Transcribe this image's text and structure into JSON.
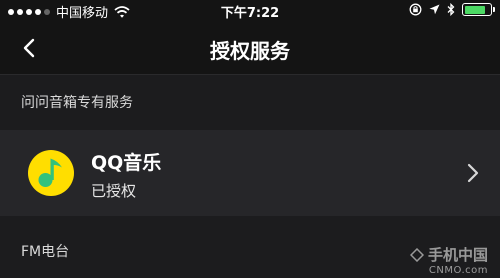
{
  "status_bar": {
    "carrier": "中国移动",
    "time": "下午7:22",
    "battery_level": 0.85,
    "battery_color": "#4cd964"
  },
  "nav": {
    "back_icon": "chevron-left-icon",
    "title": "授权服务"
  },
  "sections": {
    "exclusive_header": "问问音箱专有服务",
    "fm_header": "FM电台"
  },
  "service": {
    "name": "QQ音乐",
    "status": "已授权",
    "logo_icon": "qq-music-logo-icon",
    "logo_color": "#ffde00",
    "note_color": "#31c27c"
  },
  "watermark": {
    "line1": "手机中国",
    "line2": "CNMO.com"
  }
}
